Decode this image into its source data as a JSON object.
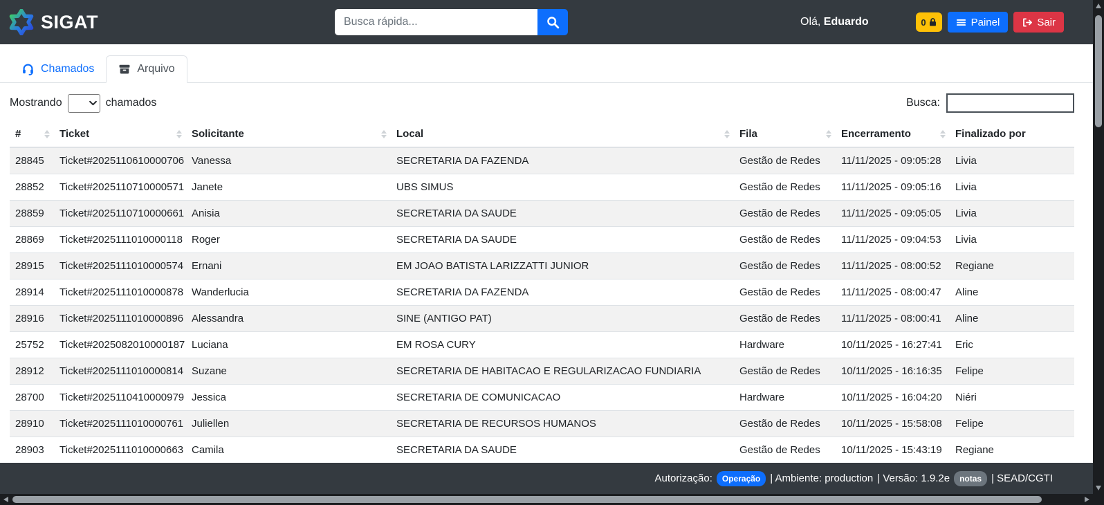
{
  "header": {
    "brand": "SIGAT",
    "search_placeholder": "Busca rápida...",
    "search_value": "",
    "greeting_prefix": "Olá,",
    "user_name": "Eduardo",
    "lock_badge_count": "0",
    "painel_label": "Painel",
    "sair_label": "Sair"
  },
  "tabs": {
    "chamados": "Chamados",
    "arquivo": "Arquivo"
  },
  "controls": {
    "mostrando_prefix": "Mostrando",
    "mostrando_value": "",
    "mostrando_suffix": "chamados",
    "busca_label": "Busca:",
    "busca_value": ""
  },
  "table": {
    "columns": [
      "#",
      "Ticket",
      "Solicitante",
      "Local",
      "Fila",
      "Encerramento",
      "Finalizado por"
    ],
    "rows": [
      [
        "28845",
        "Ticket#2025110610000706",
        "Vanessa",
        "SECRETARIA DA FAZENDA",
        "Gestão de Redes",
        "11/11/2025 - 09:05:28",
        "Livia"
      ],
      [
        "28852",
        "Ticket#2025110710000571",
        "Janete",
        "UBS SIMUS",
        "Gestão de Redes",
        "11/11/2025 - 09:05:16",
        "Livia"
      ],
      [
        "28859",
        "Ticket#2025110710000661",
        "Anisia",
        "SECRETARIA DA SAUDE",
        "Gestão de Redes",
        "11/11/2025 - 09:05:05",
        "Livia"
      ],
      [
        "28869",
        "Ticket#2025111010000118",
        "Roger",
        "SECRETARIA DA SAUDE",
        "Gestão de Redes",
        "11/11/2025 - 09:04:53",
        "Livia"
      ],
      [
        "28915",
        "Ticket#2025111010000574",
        "Ernani",
        "EM JOAO BATISTA LARIZZATTI JUNIOR",
        "Gestão de Redes",
        "11/11/2025 - 08:00:52",
        "Regiane"
      ],
      [
        "28914",
        "Ticket#2025111010000878",
        "Wanderlucia",
        "SECRETARIA DA FAZENDA",
        "Gestão de Redes",
        "11/11/2025 - 08:00:47",
        "Aline"
      ],
      [
        "28916",
        "Ticket#2025111010000896",
        "Alessandra",
        "SINE (ANTIGO PAT)",
        "Gestão de Redes",
        "11/11/2025 - 08:00:41",
        "Aline"
      ],
      [
        "25752",
        "Ticket#2025082010000187",
        "Luciana",
        "EM ROSA CURY",
        "Hardware",
        "10/11/2025 - 16:27:41",
        "Eric"
      ],
      [
        "28912",
        "Ticket#2025111010000814",
        "Suzane",
        "SECRETARIA DE HABITACAO E REGULARIZACAO FUNDIARIA",
        "Gestão de Redes",
        "10/11/2025 - 16:16:35",
        "Felipe"
      ],
      [
        "28700",
        "Ticket#2025110410000979",
        "Jessica",
        "SECRETARIA DE COMUNICACAO",
        "Hardware",
        "10/11/2025 - 16:04:20",
        "Niéri"
      ],
      [
        "28910",
        "Ticket#2025111010000761",
        "Juliellen",
        "SECRETARIA DE RECURSOS HUMANOS",
        "Gestão de Redes",
        "10/11/2025 - 15:58:08",
        "Felipe"
      ],
      [
        "28903",
        "Ticket#2025111010000663",
        "Camila",
        "SECRETARIA DA SAUDE",
        "Gestão de Redes",
        "10/11/2025 - 15:43:19",
        "Regiane"
      ]
    ]
  },
  "footer": {
    "autorizacao_label": "Autorização:",
    "autorizacao_badge": "Operação",
    "ambiente_segment": "| Ambiente: production",
    "versao_segment": "| Versão: 1.9.2e",
    "notas_badge": "notas",
    "org_segment": "| SEAD/CGTI"
  },
  "colors": {
    "header_dark": "#343a40",
    "accent_blue": "#0d6efd",
    "danger_red": "#dc3545",
    "warning_yellow": "#ffc107"
  }
}
